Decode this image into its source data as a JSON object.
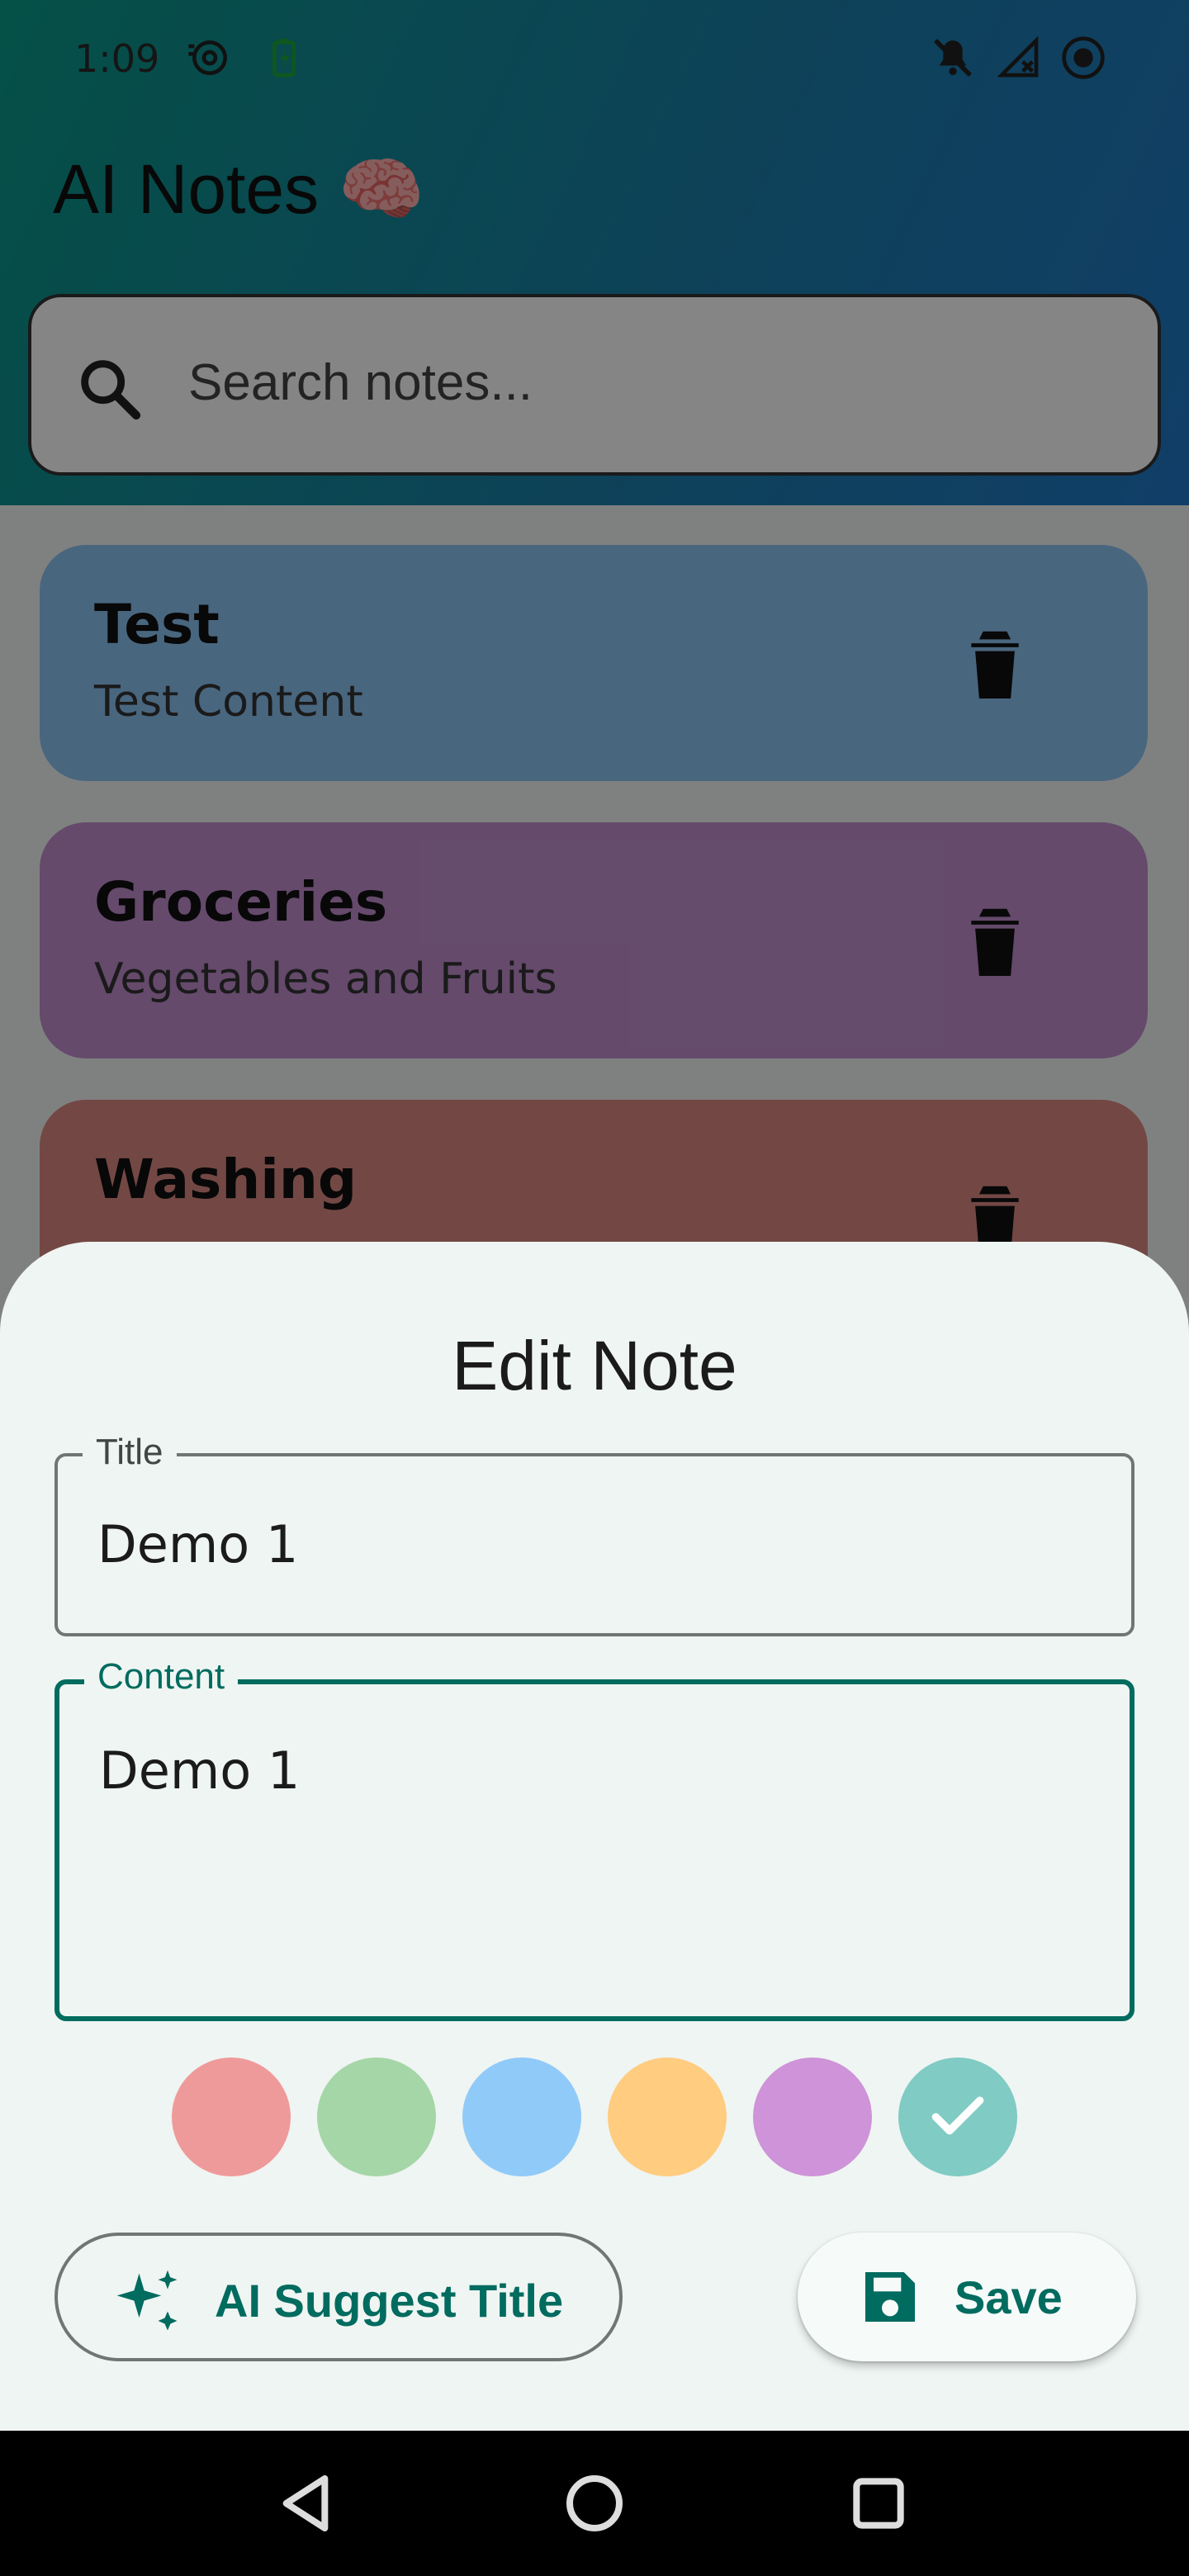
{
  "status_bar": {
    "time": "1:09",
    "icons": [
      "speed-icon",
      "battery-charging-icon",
      "notifications-off-icon",
      "signal-off-icon",
      "record-icon"
    ]
  },
  "app": {
    "title": "AI Notes 🧠",
    "search": {
      "placeholder": "Search notes..."
    }
  },
  "notes": [
    {
      "title": "Test",
      "content": "Test Content",
      "color": "#8cc3f4"
    },
    {
      "title": "Groceries",
      "content": "Vegetables and Fruits",
      "color": "#c18fcf"
    },
    {
      "title": "Washing",
      "content": "",
      "color": "#dc8a82"
    }
  ],
  "sheet": {
    "title": "Edit Note",
    "title_field": {
      "label": "Title",
      "value": "Demo 1"
    },
    "content_field": {
      "label": "Content",
      "value": "Demo 1"
    },
    "colors": [
      {
        "name": "red",
        "hex": "#ef9a9a",
        "selected": false
      },
      {
        "name": "green",
        "hex": "#a5d6a7",
        "selected": false
      },
      {
        "name": "blue",
        "hex": "#90caf9",
        "selected": false
      },
      {
        "name": "orange",
        "hex": "#ffcc80",
        "selected": false
      },
      {
        "name": "purple",
        "hex": "#ce93d8",
        "selected": false
      },
      {
        "name": "teal",
        "hex": "#80cbc4",
        "selected": true
      }
    ],
    "ai_button_label": "AI Suggest Title",
    "save_button_label": "Save"
  },
  "theme": {
    "accent": "#006b5f",
    "sheet_bg": "#eff5f2"
  }
}
